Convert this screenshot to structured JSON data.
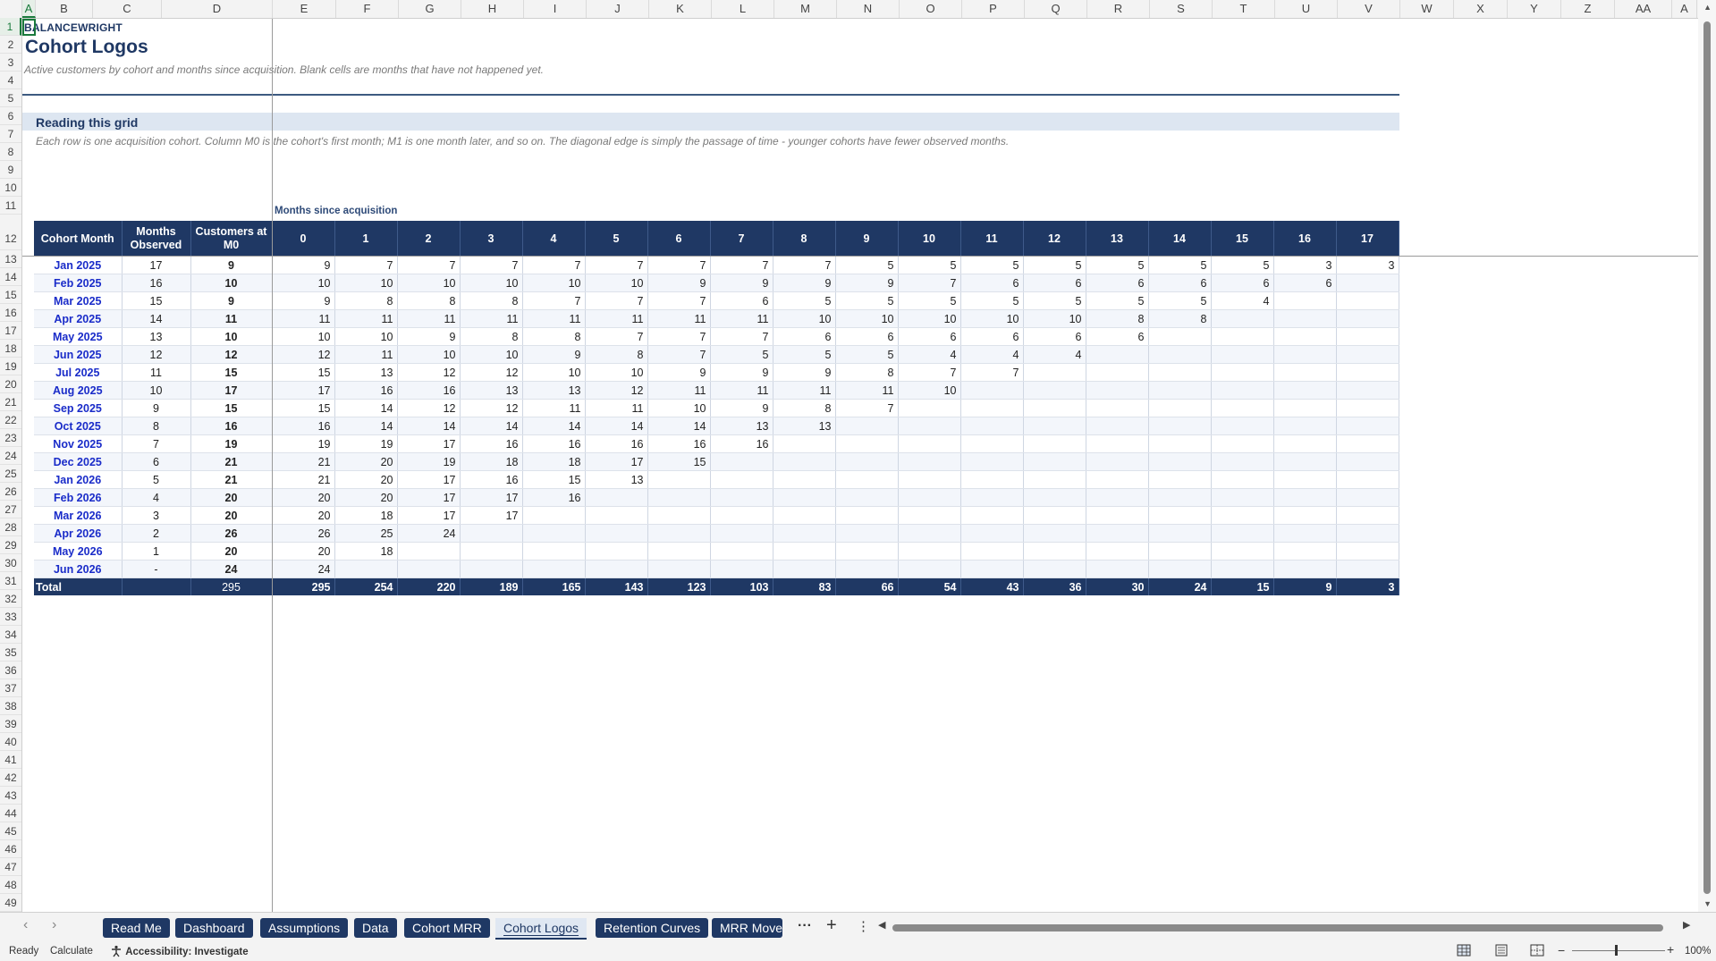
{
  "sheet": {
    "brand": "BALANCEWRIGHT",
    "title": "Cohort Logos",
    "subtitle": "Active customers by cohort and months since acquisition.  Blank cells are months that have not happened yet.",
    "section_title": "Reading this grid",
    "section_note": "Each row is one acquisition cohort. Column M0 is the cohort's first month; M1 is one month later, and so on. The diagonal edge is simply the passage of time - younger cohorts have fewer observed months.",
    "months_since_label": "Months since acquisition"
  },
  "grid": {
    "columns": [
      "A",
      "B",
      "C",
      "D",
      "E",
      "F",
      "G",
      "H",
      "I",
      "J",
      "K",
      "L",
      "M",
      "N",
      "O",
      "P",
      "Q",
      "R",
      "S",
      "T",
      "U",
      "V",
      "W",
      "X",
      "Y",
      "Z",
      "AA",
      "A"
    ],
    "selected_cell": "A1",
    "visible_rows_from": 1,
    "visible_rows_to": 49
  },
  "cohort_table": {
    "headers": {
      "cohort_month": "Cohort Month",
      "months_observed": "Months Observed",
      "customers_m0": "Customers at M0",
      "months": [
        "0",
        "1",
        "2",
        "3",
        "4",
        "5",
        "6",
        "7",
        "8",
        "9",
        "10",
        "11",
        "12",
        "13",
        "14",
        "15",
        "16",
        "17"
      ]
    },
    "rows": [
      {
        "cohort": "Jan 2025",
        "observed": "17",
        "m0": "9",
        "values": [
          "9",
          "7",
          "7",
          "7",
          "7",
          "7",
          "7",
          "7",
          "7",
          "5",
          "5",
          "5",
          "5",
          "5",
          "5",
          "5",
          "3",
          "3"
        ]
      },
      {
        "cohort": "Feb 2025",
        "observed": "16",
        "m0": "10",
        "values": [
          "10",
          "10",
          "10",
          "10",
          "10",
          "10",
          "9",
          "9",
          "9",
          "9",
          "7",
          "6",
          "6",
          "6",
          "6",
          "6",
          "6",
          ""
        ]
      },
      {
        "cohort": "Mar 2025",
        "observed": "15",
        "m0": "9",
        "values": [
          "9",
          "8",
          "8",
          "8",
          "7",
          "7",
          "7",
          "6",
          "5",
          "5",
          "5",
          "5",
          "5",
          "5",
          "5",
          "4",
          "",
          ""
        ]
      },
      {
        "cohort": "Apr 2025",
        "observed": "14",
        "m0": "11",
        "values": [
          "11",
          "11",
          "11",
          "11",
          "11",
          "11",
          "11",
          "11",
          "10",
          "10",
          "10",
          "10",
          "10",
          "8",
          "8",
          "",
          "",
          ""
        ]
      },
      {
        "cohort": "May 2025",
        "observed": "13",
        "m0": "10",
        "values": [
          "10",
          "10",
          "9",
          "8",
          "8",
          "7",
          "7",
          "7",
          "6",
          "6",
          "6",
          "6",
          "6",
          "6",
          "",
          "",
          "",
          ""
        ]
      },
      {
        "cohort": "Jun 2025",
        "observed": "12",
        "m0": "12",
        "values": [
          "12",
          "11",
          "10",
          "10",
          "9",
          "8",
          "7",
          "5",
          "5",
          "5",
          "4",
          "4",
          "4",
          "",
          "",
          "",
          "",
          ""
        ]
      },
      {
        "cohort": "Jul 2025",
        "observed": "11",
        "m0": "15",
        "values": [
          "15",
          "13",
          "12",
          "12",
          "10",
          "10",
          "9",
          "9",
          "9",
          "8",
          "7",
          "7",
          "",
          "",
          "",
          "",
          "",
          ""
        ]
      },
      {
        "cohort": "Aug 2025",
        "observed": "10",
        "m0": "17",
        "values": [
          "17",
          "16",
          "16",
          "13",
          "13",
          "12",
          "11",
          "11",
          "11",
          "11",
          "10",
          "",
          "",
          "",
          "",
          "",
          "",
          ""
        ]
      },
      {
        "cohort": "Sep 2025",
        "observed": "9",
        "m0": "15",
        "values": [
          "15",
          "14",
          "12",
          "12",
          "11",
          "11",
          "10",
          "9",
          "8",
          "7",
          "",
          "",
          "",
          "",
          "",
          "",
          "",
          ""
        ]
      },
      {
        "cohort": "Oct 2025",
        "observed": "8",
        "m0": "16",
        "values": [
          "16",
          "14",
          "14",
          "14",
          "14",
          "14",
          "14",
          "13",
          "13",
          "",
          "",
          "",
          "",
          "",
          "",
          "",
          "",
          ""
        ]
      },
      {
        "cohort": "Nov 2025",
        "observed": "7",
        "m0": "19",
        "values": [
          "19",
          "19",
          "17",
          "16",
          "16",
          "16",
          "16",
          "16",
          "",
          "",
          "",
          "",
          "",
          "",
          "",
          "",
          "",
          ""
        ]
      },
      {
        "cohort": "Dec 2025",
        "observed": "6",
        "m0": "21",
        "values": [
          "21",
          "20",
          "19",
          "18",
          "18",
          "17",
          "15",
          "",
          "",
          "",
          "",
          "",
          "",
          "",
          "",
          "",
          "",
          ""
        ]
      },
      {
        "cohort": "Jan 2026",
        "observed": "5",
        "m0": "21",
        "values": [
          "21",
          "20",
          "17",
          "16",
          "15",
          "13",
          "",
          "",
          "",
          "",
          "",
          "",
          "",
          "",
          "",
          "",
          "",
          ""
        ]
      },
      {
        "cohort": "Feb 2026",
        "observed": "4",
        "m0": "20",
        "values": [
          "20",
          "20",
          "17",
          "17",
          "16",
          "",
          "",
          "",
          "",
          "",
          "",
          "",
          "",
          "",
          "",
          "",
          "",
          ""
        ]
      },
      {
        "cohort": "Mar 2026",
        "observed": "3",
        "m0": "20",
        "values": [
          "20",
          "18",
          "17",
          "17",
          "",
          "",
          "",
          "",
          "",
          "",
          "",
          "",
          "",
          "",
          "",
          "",
          "",
          ""
        ]
      },
      {
        "cohort": "Apr 2026",
        "observed": "2",
        "m0": "26",
        "values": [
          "26",
          "25",
          "24",
          "",
          "",
          "",
          "",
          "",
          "",
          "",
          "",
          "",
          "",
          "",
          "",
          "",
          "",
          ""
        ]
      },
      {
        "cohort": "May 2026",
        "observed": "1",
        "m0": "20",
        "values": [
          "20",
          "18",
          "",
          "",
          "",
          "",
          "",
          "",
          "",
          "",
          "",
          "",
          "",
          "",
          "",
          "",
          "",
          ""
        ]
      },
      {
        "cohort": "Jun 2026",
        "observed": "-",
        "m0": "24",
        "values": [
          "24",
          "",
          "",
          "",
          "",
          "",
          "",
          "",
          "",
          "",
          "",
          "",
          "",
          "",
          "",
          "",
          "",
          ""
        ]
      }
    ],
    "total": {
      "label": "Total",
      "observed": "",
      "m0": "295",
      "values": [
        "295",
        "254",
        "220",
        "189",
        "165",
        "143",
        "123",
        "103",
        "83",
        "66",
        "54",
        "43",
        "36",
        "30",
        "24",
        "15",
        "9",
        "3"
      ]
    }
  },
  "tabs": {
    "items": [
      "Read Me",
      "Dashboard",
      "Assumptions",
      "Data",
      "Cohort MRR",
      "Cohort Logos",
      "Retention Curves",
      "MRR Moven"
    ],
    "active": "Cohort Logos",
    "more_icon": "more-horizontal-icon",
    "add_icon": "plus-icon",
    "options_icon": "kebab-vertical-icon"
  },
  "status": {
    "ready": "Ready",
    "calculate": "Calculate",
    "accessibility": "Accessibility: Investigate",
    "zoom": "100%"
  },
  "colors": {
    "header_navy": "#1f3864",
    "band_light": "#dde6f1",
    "cohort_blue": "#1a2cc9",
    "selection_green": "#1a7a3c"
  }
}
